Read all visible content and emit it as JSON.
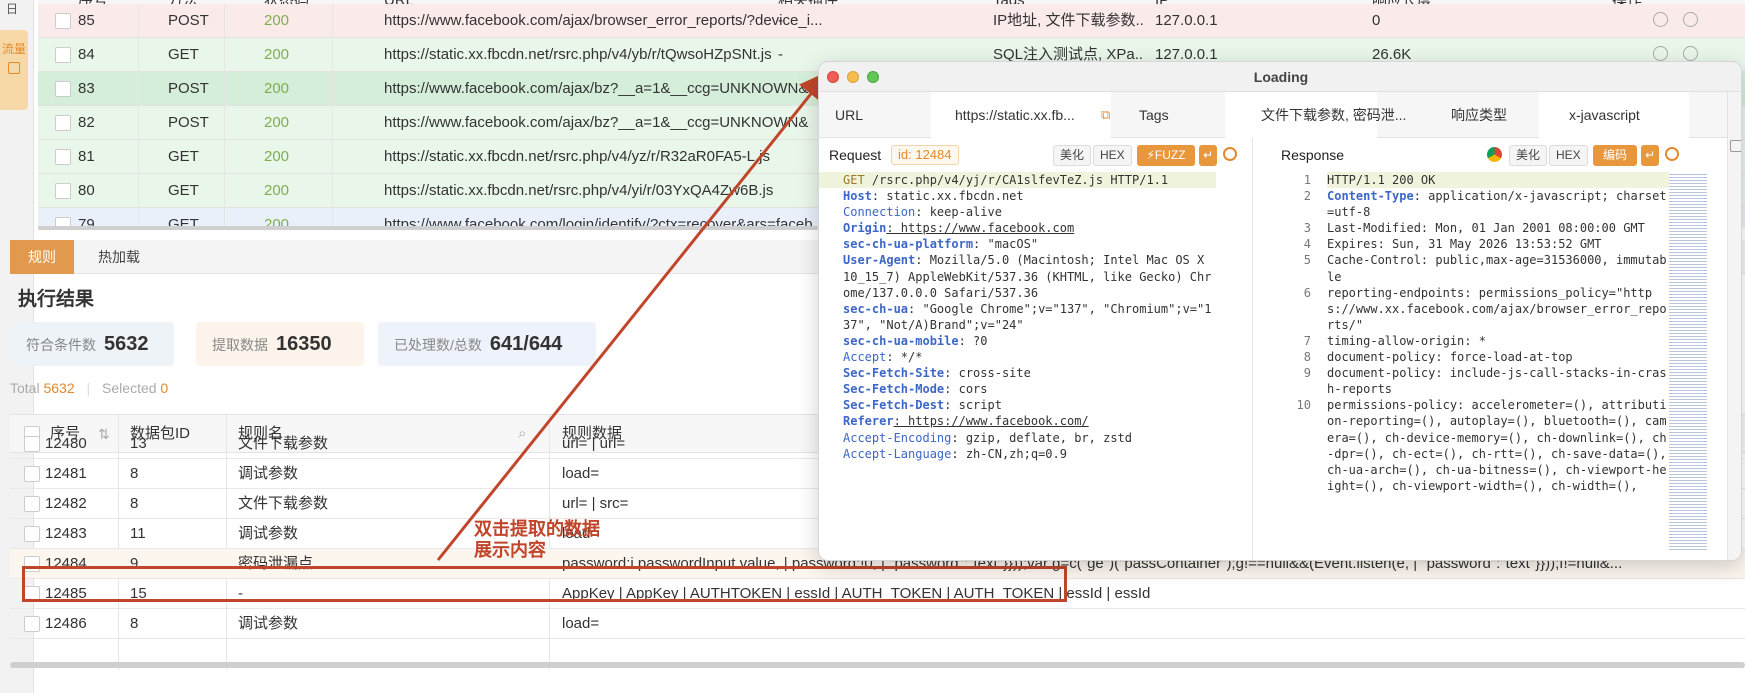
{
  "sidebar": {
    "top_glyph": "日",
    "tab_label": "流量"
  },
  "top_table": {
    "header": [
      "序号",
      "方法",
      "状态码",
      "URL",
      "相关插件",
      "Tags",
      "IP",
      "响应长度",
      "操作"
    ],
    "rows": [
      {
        "no": "85",
        "method": "POST",
        "status": "200",
        "url": "https://www.facebook.com/ajax/browser_error_reports/?device_i...",
        "plugin": "-",
        "tags": "IP地址, 文件下载参数...",
        "ip": "127.0.0.1",
        "len": "0"
      },
      {
        "no": "84",
        "method": "GET",
        "status": "200",
        "url": "https://static.xx.fbcdn.net/rsrc.php/v4/yb/r/tQwsoHZpSNt.js",
        "plugin": "-",
        "tags": "SQL注入测试点, XPa...",
        "ip": "127.0.0.1",
        "len": "26.6K"
      },
      {
        "no": "83",
        "method": "POST",
        "status": "200",
        "url": "https://www.facebook.com/ajax/bz?__a=1&__ccg=UNKNOWN&",
        "plugin": "",
        "tags": "",
        "ip": "",
        "len": ""
      },
      {
        "no": "82",
        "method": "POST",
        "status": "200",
        "url": "https://www.facebook.com/ajax/bz?__a=1&__ccg=UNKNOWN&",
        "plugin": "",
        "tags": "",
        "ip": "",
        "len": ""
      },
      {
        "no": "81",
        "method": "GET",
        "status": "200",
        "url": "https://static.xx.fbcdn.net/rsrc.php/v4/yz/r/R32aR0FA5-L.js",
        "plugin": "",
        "tags": "",
        "ip": "",
        "len": ""
      },
      {
        "no": "80",
        "method": "GET",
        "status": "200",
        "url": "https://static.xx.fbcdn.net/rsrc.php/v4/yi/r/03YxQA4Zw6B.js",
        "plugin": "",
        "tags": "",
        "ip": "",
        "len": ""
      },
      {
        "no": "79",
        "method": "GET",
        "status": "200",
        "url": "https://www.facebook.com/login/identify/?ctx=recover&ars=faceb...",
        "plugin": "",
        "tags": "",
        "ip": "",
        "len": ""
      }
    ]
  },
  "tabs": {
    "rules": "规则",
    "hot_reload": "热加载"
  },
  "exec": {
    "title": "执行结果"
  },
  "stats": {
    "matched_label": "符合条件数",
    "matched_value": "5632",
    "extracted_label": "提取数据",
    "extracted_value": "16350",
    "processed_label": "已处理数/总数",
    "processed_value": "641/644"
  },
  "totals": {
    "total_label": "Total",
    "total_value": "5632",
    "selected_label": "Selected",
    "selected_value": "0"
  },
  "bottom_table": {
    "header": {
      "no": "序号",
      "pkt": "数据包ID",
      "name": "规则名",
      "data": "规则数据"
    },
    "rows": [
      {
        "no": "12480",
        "pkt": "13",
        "name": "文件下载参数",
        "data": "url= | url="
      },
      {
        "no": "12481",
        "pkt": "8",
        "name": "调试参数",
        "data": "load="
      },
      {
        "no": "12482",
        "pkt": "8",
        "name": "文件下载参数",
        "data": "url= | src="
      },
      {
        "no": "12483",
        "pkt": "11",
        "name": "调试参数",
        "data": "load="
      },
      {
        "no": "12484",
        "pkt": "9",
        "name": "密码泄漏点",
        "data": "password:i.passwordInput.value, | password:!0, | \"password\":\"text\"}}));var g=c(\"ge\")(\"passContainer\");g!==null&&(Event.listen(e, | \"password\":\"text\"}}));f!=null&..."
      },
      {
        "no": "12485",
        "pkt": "15",
        "name": "-",
        "data": "AppKey | AppKey | AUTHTOKEN | essId | AUTH_TOKEN | AUTH_TOKEN | essId | essId"
      },
      {
        "no": "12486",
        "pkt": "8",
        "name": "调试参数",
        "data": "load="
      }
    ]
  },
  "annotation": {
    "line1": "双击提取的数据",
    "line2": "展示内容"
  },
  "window": {
    "title": "Loading",
    "url_label": "URL",
    "url_value": "https://static.xx.fb...",
    "tags_label": "Tags",
    "tags_value": "文件下载参数, 密码泄...",
    "ctype_label": "响应类型",
    "ctype_value": "x-javascript",
    "request": {
      "label": "Request",
      "id": "id: 12484",
      "beautify": "美化",
      "hex": "HEX",
      "fuzz": "FUZZ"
    },
    "response": {
      "label": "Response",
      "beautify": "美化",
      "hex": "HEX",
      "encode": "编码"
    }
  },
  "request_lines": [
    {
      "k": "GET",
      "v": " /rsrc.php/v4/yj/r/CA1slfevTeZ.js HTTP/1.1"
    },
    {
      "k": "Host",
      "v": ": static.xx.fbcdn.net"
    },
    {
      "k": "Connection",
      "v": ": keep-alive"
    },
    {
      "k": "Origin",
      "v": ": https://www.facebook.com"
    },
    {
      "k": "sec-ch-ua-platform",
      "v": ": \"macOS\""
    },
    {
      "k": "User-Agent",
      "v": ": Mozilla/5.0 (Macintosh; Intel Mac OS X 10_15_7) AppleWebKit/537.36 (KHTML, like Gecko) Chrome/137.0.0.0 Safari/537.36"
    },
    {
      "k": "sec-ch-ua",
      "v": ": \"Google Chrome\";v=\"137\", \"Chromium\";v=\"137\", \"Not/A)Brand\";v=\"24\""
    },
    {
      "k": "sec-ch-ua-mobile",
      "v": ": ?0"
    },
    {
      "k": "Accept",
      "v": ": */*"
    },
    {
      "k": "Sec-Fetch-Site",
      "v": ": cross-site"
    },
    {
      "k": "Sec-Fetch-Mode",
      "v": ": cors"
    },
    {
      "k": "Sec-Fetch-Dest",
      "v": ": script"
    },
    {
      "k": "Referer",
      "v": ": https://www.facebook.com/"
    },
    {
      "k": "Accept-Encoding",
      "v": ": gzip, deflate, br, zstd"
    },
    {
      "k": "Accept-Language",
      "v": ": zh-CN,zh;q=0.9"
    }
  ],
  "response_lines": [
    {
      "n": "1",
      "t": "HTTP/1.1 200 OK"
    },
    {
      "n": "2",
      "k": "Content-Type",
      "v": ": application/x-javascript; charset=utf-8"
    },
    {
      "n": "3",
      "t": "Last-Modified: Mon, 01 Jan 2001 08:00:00 GMT"
    },
    {
      "n": "4",
      "t": "Expires: Sun, 31 May 2026 13:53:52 GMT"
    },
    {
      "n": "5",
      "t": "Cache-Control: public,max-age=31536000, immutable"
    },
    {
      "n": "6",
      "t": "reporting-endpoints: permissions_policy=\"https://www.xx.facebook.com/ajax/browser_error_reports/\""
    },
    {
      "n": "7",
      "t": "timing-allow-origin: *"
    },
    {
      "n": "8",
      "t": "document-policy: force-load-at-top"
    },
    {
      "n": "9",
      "t": "document-policy: include-js-call-stacks-in-crash-reports"
    },
    {
      "n": "10",
      "t": "permissions-policy: accelerometer=(), attribution-reporting=(), autoplay=(), bluetooth=(), camera=(), ch-device-memory=(), ch-downlink=(), ch-dpr=(), ch-ect=(), ch-rtt=(), ch-save-data=(), ch-ua-arch=(), ch-ua-bitness=(), ch-viewport-height=(), ch-viewport-width=(), ch-width=(),"
    }
  ],
  "colors": {
    "accent": "#e8973d",
    "status_ok": "#7fae4d",
    "annotation": "#c0452a",
    "selected_row": "#d5eed9",
    "row_green": "#e9f6ea",
    "row_red": "#fbeaea"
  }
}
